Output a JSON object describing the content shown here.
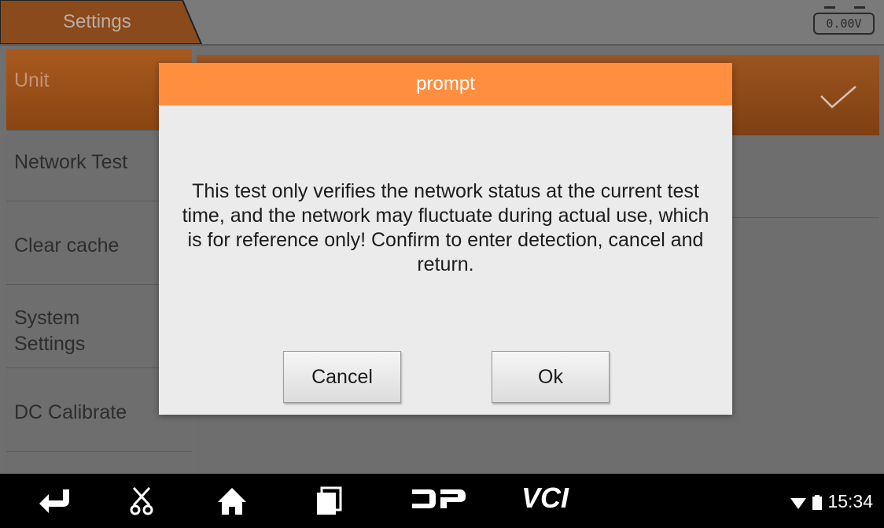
{
  "header": {
    "title": "Settings",
    "voltage": "0.00V"
  },
  "sidebar": {
    "items": [
      {
        "label": "Unit"
      },
      {
        "label": "Network Test"
      },
      {
        "label": "Clear cache"
      },
      {
        "label": "System Settings"
      },
      {
        "label": "DC Calibrate"
      }
    ]
  },
  "dialog": {
    "title": "prompt",
    "message": "This test only verifies the network status at the current test time, and the network may fluctuate during actual use, which is for reference only! Confirm to enter detection, cancel and return.",
    "cancel_label": "Cancel",
    "ok_label": "Ok"
  },
  "navbar": {
    "icons": [
      "back-icon",
      "scissors-icon",
      "home-icon",
      "recent-apps-icon",
      "dp-logo-icon",
      "vci-icon"
    ],
    "vci_label": "VCI",
    "time": "15:34"
  },
  "colors": {
    "accent": "#ff8f3f",
    "active_item": "#a95a1e"
  }
}
